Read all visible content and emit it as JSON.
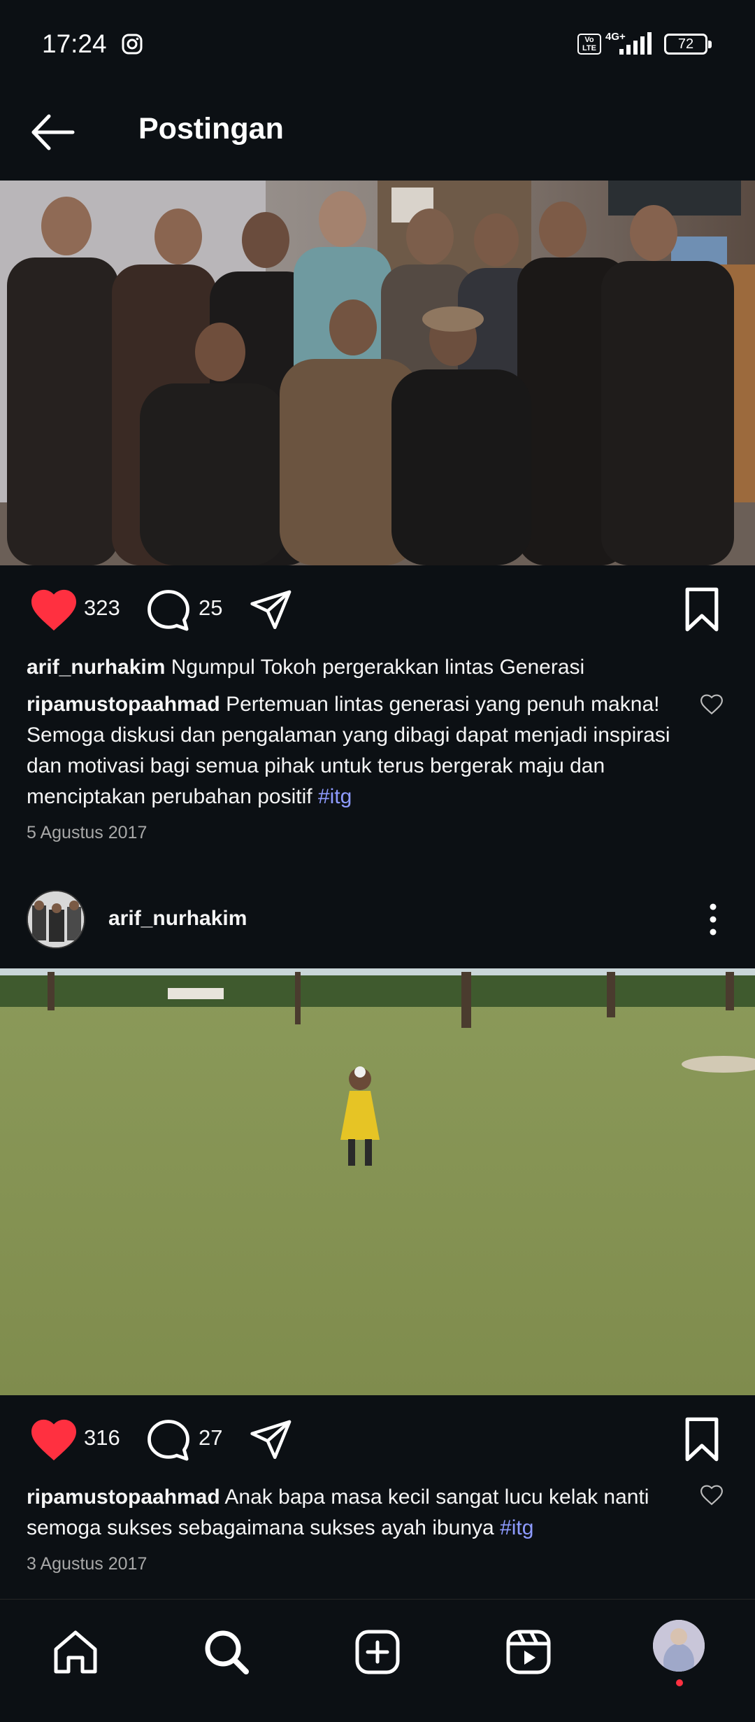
{
  "status_bar": {
    "time": "17:24",
    "network": "4G+",
    "battery": "72",
    "volte": "Vo LTE"
  },
  "header": {
    "title": "Postingan"
  },
  "post1": {
    "likes": "323",
    "comments": "25",
    "caption_user": "arif_nurhakim",
    "caption_text": "Ngumpul Tokoh pergerakkan lintas Generasi",
    "comment_user": "ripamustopaahmad",
    "comment_text": "Pertemuan lintas generasi yang penuh makna! Semoga diskusi dan pengalaman yang dibagi dapat menjadi inspirasi dan motivasi bagi semua pihak untuk terus bergerak maju dan menciptakan perubahan positif",
    "comment_tag": "#itg",
    "date": "5 Agustus 2017"
  },
  "post2": {
    "username": "arif_nurhakim",
    "likes": "316",
    "comments": "27",
    "comment_user": "ripamustopaahmad",
    "comment_text": "Anak bapa masa kecil sangat lucu kelak nanti semoga sukses sebagaimana sukses ayah ibunya",
    "comment_tag": "#itg",
    "date": "3 Agustus 2017"
  },
  "icons": {
    "back": "arrow-left-icon",
    "like": "heart-icon",
    "comment": "comment-icon",
    "share": "send-icon",
    "save": "bookmark-icon",
    "more": "more-vertical-icon",
    "home": "home-icon",
    "search": "search-icon",
    "create": "plus-square-icon",
    "reels": "reels-icon"
  },
  "colors": {
    "background": "#0c1014",
    "like_red": "#ff3040",
    "hashtag": "#8e9bff",
    "muted_text": "#a8a8a8"
  }
}
